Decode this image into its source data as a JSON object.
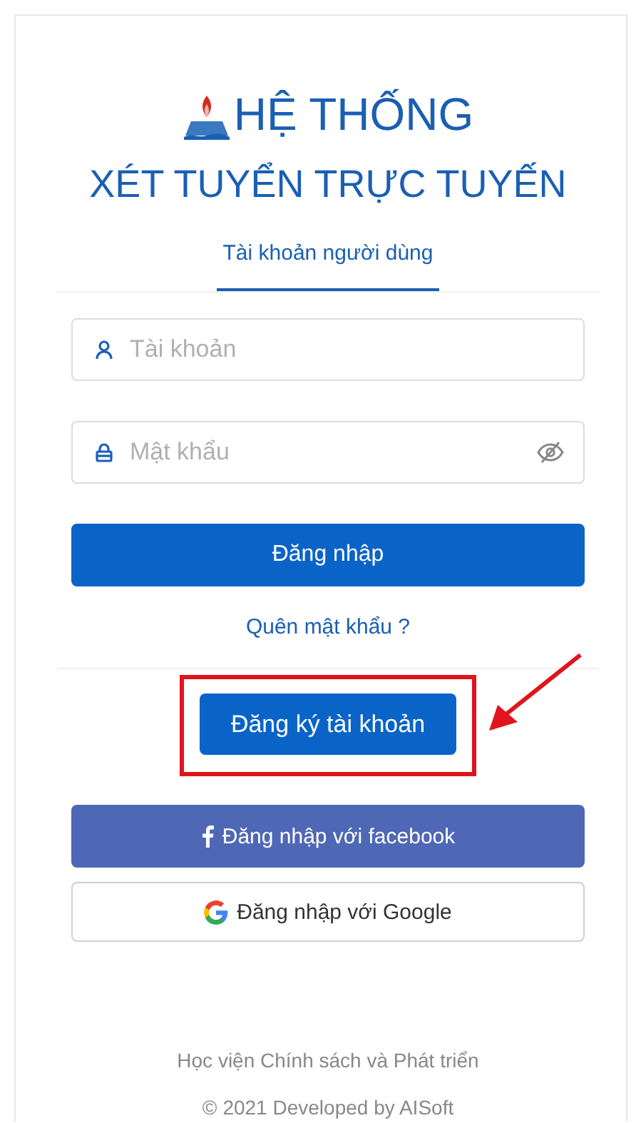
{
  "header": {
    "title_line_1": "HỆ THỐNG",
    "title_line_2": "XÉT TUYỂN TRỰC TUYẾN"
  },
  "tabs": [
    {
      "label": "Tài khoản người dùng",
      "selected": true
    }
  ],
  "form": {
    "fields": [
      {
        "kind": "user",
        "placeholder": "Tài khoản"
      },
      {
        "kind": "password",
        "placeholder": "Mật khẩu"
      }
    ],
    "login_button": "Đăng nhập",
    "forgot_link": "Quên mật khẩu ?",
    "register_button": "Đăng ký tài khoản",
    "register_highlighted": true
  },
  "social_buttons": [
    {
      "kind": "facebook",
      "label": "Đăng nhập với facebook"
    },
    {
      "kind": "google",
      "label": "Đăng nhập với Google"
    }
  ],
  "footer": {
    "organization": "Học viện Chính sách và Phát triển",
    "copyright_symbol": "©",
    "copyright": "2021 Developed by AISoft"
  }
}
